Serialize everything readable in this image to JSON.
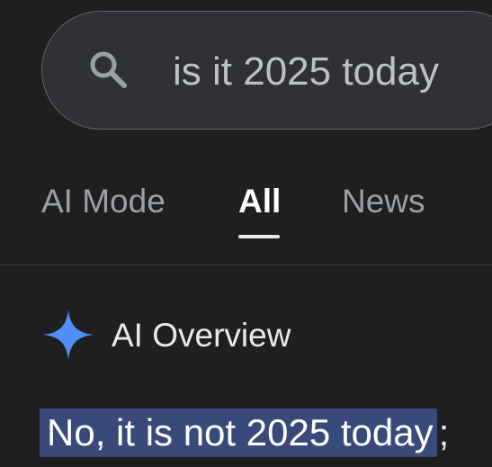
{
  "search": {
    "query": "is it 2025 today",
    "icon": "search-icon"
  },
  "tabs": [
    {
      "label": "AI Mode",
      "active": false
    },
    {
      "label": "All",
      "active": true
    },
    {
      "label": "News",
      "active": false
    }
  ],
  "ai_overview": {
    "icon": "sparkle-icon",
    "title": "AI Overview",
    "answer_highlight": "No, it is not 2025 today",
    "answer_tail": ";",
    "highlight_color": "#394a7a",
    "sparkle_color": "#4f8ff7"
  }
}
